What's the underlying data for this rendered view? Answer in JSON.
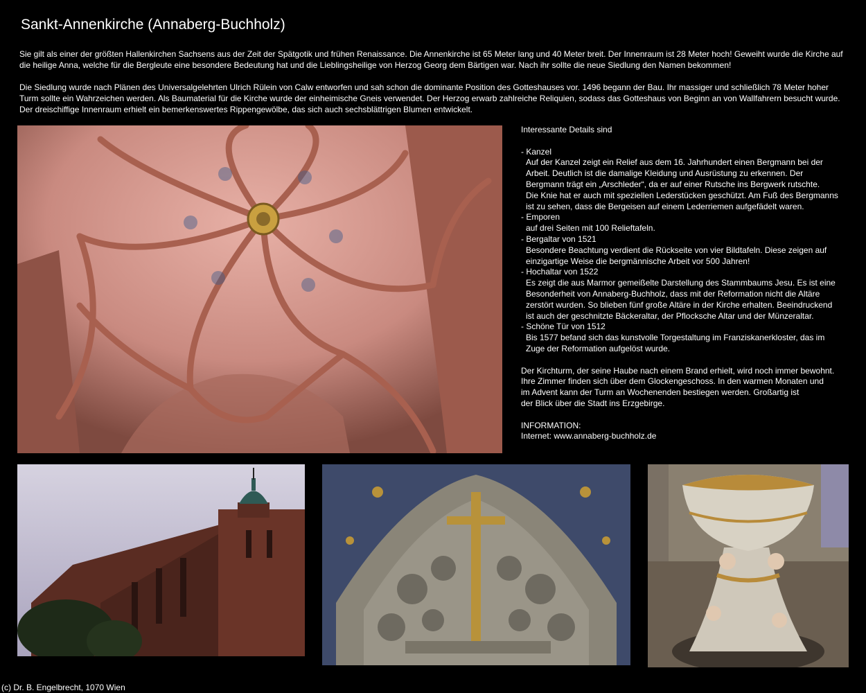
{
  "page": {
    "title": "Sankt-Annenkirche (Annaberg-Buchholz)",
    "footer": "(c) Dr. B. Engelbrecht, 1070 Wien"
  },
  "intro": {
    "paragraphs": [
      "Sie gilt als einer der größten Hallenkirchen Sachsens aus der Zeit der Spätgotik und frühen Renaissance. Die Annenkirche ist 65 Meter lang und 40 Meter breit. Der Innenraum ist 28 Meter hoch! Geweiht wurde die Kirche auf die heilige Anna, welche für die Bergleute eine besondere Bedeutung hat und die Lieblingsheilige von Herzog Georg dem Bärtigen war. Nach ihr sollte die neue Siedlung den Namen bekommen!",
      "Die Siedlung wurde nach Plänen des Universalgelehrten Ulrich Rülein von Calw entworfen und sah schon die dominante Position des Gotteshauses vor. 1496 begann der Bau. Ihr massiger und schließlich 78 Meter hoher Turm sollte ein Wahrzeichen werden. Als Baumaterial für die Kirche wurde der einheimische Gneis verwendet. Der Herzog erwarb zahlreiche Reliquien, sodass das Gotteshaus von Beginn an von Wallfahrern besucht wurde. Der dreischiffige Innenraum erhielt ein bemerkenswertes Rippengewölbe, das sich auch sechsblättrigen Blumen entwickelt."
    ]
  },
  "details": {
    "heading": "Interessante Details sind",
    "items": [
      {
        "head": "- Kanzel",
        "body": [
          "Auf der Kanzel zeigt ein Relief aus dem 16. Jahrhundert einen Bergmann bei der",
          "Arbeit. Deutlich ist die damalige Kleidung und Ausrüstung zu erkennen. Der",
          "Bergmann trägt ein „Arschleder“, da er auf einer Rutsche ins Bergwerk rutschte.",
          "Die Knie hat er auch mit speziellen Lederstücken geschützt. Am Fuß des Bergmanns",
          "ist zu sehen, dass die Bergeisen auf einem Lederriemen aufgefädelt waren."
        ]
      },
      {
        "head": "- Emporen",
        "body": [
          "auf drei Seiten mit 100 Relieftafeln."
        ]
      },
      {
        "head": "- Bergaltar von 1521",
        "body": [
          "Besondere Beachtung verdient die Rückseite von vier Bildtafeln. Diese zeigen auf",
          "einzigartige Weise die bergmännische Arbeit vor 500 Jahren!"
        ]
      },
      {
        "head": "- Hochaltar von 1522",
        "body": [
          "Es zeigt die aus Marmor gemeißelte Darstellung des Stammbaums Jesu. Es ist eine",
          "Besonderheit von Annaberg-Buchholz, dass mit der Reformation nicht die Altäre",
          "zerstört wurden. So blieben fünf große Altäre in der Kirche erhalten. Beeindruckend",
          "ist auch der geschnitzte Bäckeraltar, der Pflocksche Altar und der Münzeraltar."
        ]
      },
      {
        "head": "- Schöne Tür von 1512",
        "body": [
          "Bis 1577 befand sich das kunstvolle Torgestaltung im Franziskanerkloster, das im",
          "Zuge der Reformation aufgelöst wurde."
        ]
      }
    ],
    "tower_text": [
      "Der Kirchturm, der seine Haube nach einem Brand erhielt, wird noch immer bewohnt.",
      "Ihre Zimmer finden sich über dem Glockengeschoss. In den warmen Monaten und",
      "im Advent kann der Turm an Wochenenden bestiegen werden. Großartig ist",
      "der Blick über die Stadt ins Erzgebirge."
    ],
    "info_label": "INFORMATION:",
    "info_internet": "Internet: www.annaberg-buchholz.de"
  },
  "photos": {
    "vault_colors": {
      "stone": "#c98a80",
      "rib": "#a8604f",
      "boss": "#c9a040"
    },
    "exterior_colors": {
      "sky": "#b8b3c8",
      "brick": "#5a2c22",
      "roof": "#2f5a55"
    },
    "relief_colors": {
      "stone": "#8a8578",
      "gold": "#b8923a",
      "blue": "#3e4a6a"
    },
    "font_colors": {
      "floor": "#6a5e50",
      "basin": "#d8d2c4",
      "gold": "#b88b3a"
    }
  }
}
